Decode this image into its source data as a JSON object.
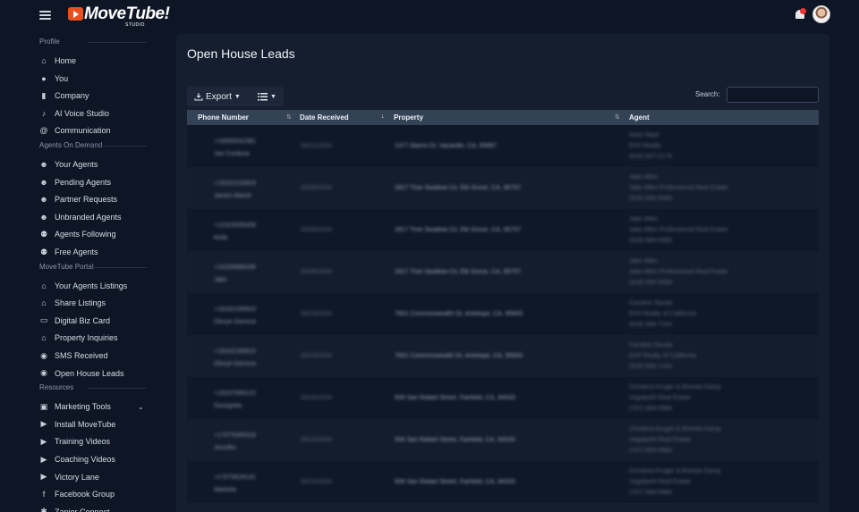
{
  "header": {
    "brand": "MoveTube!",
    "brand_sub": "STUDIO"
  },
  "sidebar": {
    "sections": [
      {
        "label": "Profile",
        "items": [
          {
            "label": "Home",
            "icon": "house-icon"
          },
          {
            "label": "You",
            "icon": "user-icon"
          },
          {
            "label": "Company",
            "icon": "building-icon"
          },
          {
            "label": "AI Voice Studio",
            "icon": "microphone-icon"
          },
          {
            "label": "Communication",
            "icon": "at-icon"
          }
        ]
      },
      {
        "label": "Agents On Demand",
        "items": [
          {
            "label": "Your Agents",
            "icon": "smile-icon"
          },
          {
            "label": "Pending Agents",
            "icon": "smile-icon"
          },
          {
            "label": "Partner Requests",
            "icon": "smile-icon"
          },
          {
            "label": "Unbranded Agents",
            "icon": "smile-icon"
          },
          {
            "label": "Agents Following",
            "icon": "users-icon"
          },
          {
            "label": "Free Agents",
            "icon": "users-icon"
          }
        ]
      },
      {
        "label": "MoveTube Portal",
        "items": [
          {
            "label": "Your Agents Listings",
            "icon": "house-icon"
          },
          {
            "label": "Share Listings",
            "icon": "share-house-icon"
          },
          {
            "label": "Digital Biz Card",
            "icon": "id-card-icon"
          },
          {
            "label": "Property Inquiries",
            "icon": "house-icon"
          },
          {
            "label": "SMS Received",
            "icon": "chat-icon"
          },
          {
            "label": "Open House Leads",
            "icon": "chat-icon"
          }
        ]
      },
      {
        "label": "Resources",
        "items": [
          {
            "label": "Marketing Tools",
            "icon": "briefcase-icon"
          },
          {
            "label": "Install MoveTube",
            "icon": "play-circle-icon"
          },
          {
            "label": "Training Videos",
            "icon": "video-icon"
          },
          {
            "label": "Coaching Videos",
            "icon": "video-icon"
          },
          {
            "label": "Victory Lane",
            "icon": "video-icon"
          },
          {
            "label": "Facebook Group",
            "icon": "facebook-icon"
          },
          {
            "label": "Zapier Connect",
            "icon": "zapier-icon"
          }
        ]
      }
    ]
  },
  "main": {
    "title": "Open House Leads",
    "export_label": "Export",
    "search_label": "Search:",
    "search_value": "",
    "columns": [
      "Phone Number",
      "Date Received",
      "Property",
      "Agent"
    ],
    "rows": [
      {
        "phone": "+18583042381",
        "name": "Joe Cordova",
        "date": "04/11/2024",
        "property": "1477 Alamo Dr, Vacaville, CA, 95687",
        "agent": "Sean Mark",
        "company": "EXP Realty",
        "agent_phone": "(916) 847-2176"
      },
      {
        "phone": "+19162103919",
        "name": "James Marsh",
        "date": "03/28/2024",
        "property": "2817 Tree Swallow Cir, Elk Grove, CA, 95757",
        "agent": "Jake Allen",
        "company": "Jake Allen Professional Real Estate",
        "agent_phone": "(916) 996-9308"
      },
      {
        "phone": "+12323595458",
        "name": "Kirile",
        "date": "03/28/2024",
        "property": "2817 Tree Swallow Cir, Elk Grove, CA, 95757",
        "agent": "Jake Allen",
        "company": "Jake Allen Professional Real Estate",
        "agent_phone": "(916) 996-9308"
      },
      {
        "phone": "+19165886336",
        "name": "Jake",
        "date": "03/28/2024",
        "property": "2817 Tree Swallow Cir, Elk Grove, CA, 95757",
        "agent": "Jake Allen",
        "company": "Jake Allen Professional Real Estate",
        "agent_phone": "(916) 996-9308"
      },
      {
        "phone": "+19162189910",
        "name": "Olurye Gemcor",
        "date": "03/23/2024",
        "property": "7601 Commonwealth Dr, Antelope, CA, 95843",
        "agent": "Candice Zavala",
        "company": "EXP Realty of California",
        "agent_phone": "(916) 996-7104"
      },
      {
        "phone": "+19162189910",
        "name": "Olurye Gemcor",
        "date": "03/23/2024",
        "property": "7601 Commonwealth Dr, Antelope, CA, 95843",
        "agent": "Candice Zavala",
        "company": "EXP Realty of California",
        "agent_phone": "(916) 996-7104"
      },
      {
        "phone": "+19107068122",
        "name": "Georgetta",
        "date": "03/16/2024",
        "property": "506 San Rafael Street, Fairfield, CA, 94533",
        "agent": "Christina Kruger & Brenda Garay",
        "company": "Vogelpohl Real Estate",
        "agent_phone": "(707) 999-0984"
      },
      {
        "phone": "+17075365316",
        "name": "Jennifer",
        "date": "03/10/2024",
        "property": "506 San Rafael Street, Fairfield, CA, 94533",
        "agent": "Christina Kruger & Brenda Garay",
        "company": "Vogelpohl Real Estate",
        "agent_phone": "(707) 999-0984"
      },
      {
        "phone": "+17079628141",
        "name": "Markela",
        "date": "03/10/2024",
        "property": "506 San Rafael Street, Fairfield, CA, 94533",
        "agent": "Christina Kruger & Brenda Garay",
        "company": "Vogelpohl Real Estate",
        "agent_phone": "(707) 999-0984"
      }
    ]
  }
}
